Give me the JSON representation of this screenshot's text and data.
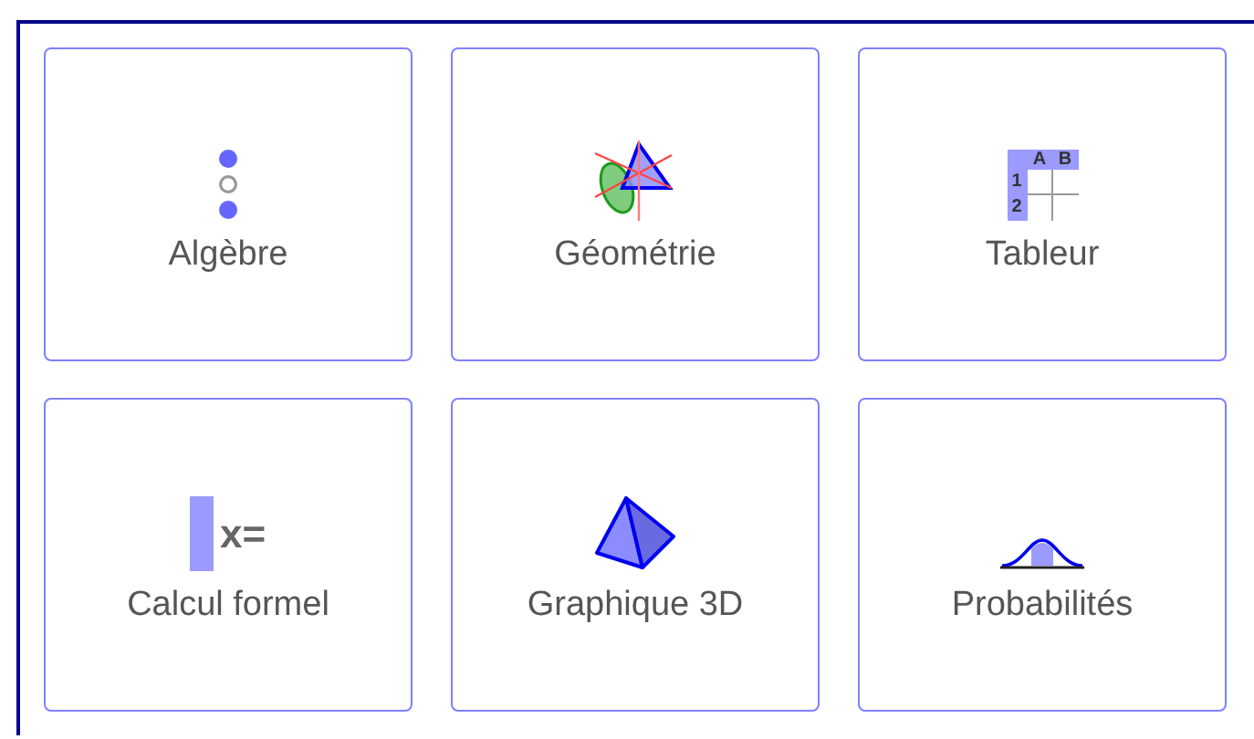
{
  "apps": [
    {
      "label": "Algèbre",
      "kind": "algebra"
    },
    {
      "label": "Géométrie",
      "kind": "geometry"
    },
    {
      "label": "Tableur",
      "kind": "spreadsheet",
      "columns": [
        "A",
        "B"
      ],
      "rows": [
        "1",
        "2"
      ]
    },
    {
      "label": "Calcul formel",
      "kind": "cas",
      "icon_text": "x="
    },
    {
      "label": "Graphique 3D",
      "kind": "graphics3d"
    },
    {
      "label": "Probabilités",
      "kind": "probability"
    }
  ]
}
